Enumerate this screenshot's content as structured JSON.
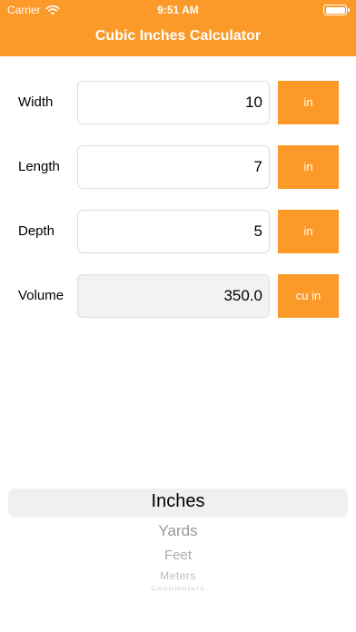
{
  "status": {
    "carrier": "Carrier",
    "time": "9:51 AM",
    "wifi_icon": "wifi-icon",
    "battery_icon": "battery-icon"
  },
  "header": {
    "title": "Cubic Inches Calculator",
    "color": "#fb9a28"
  },
  "rows": [
    {
      "label": "Width",
      "value": "10",
      "unit": "in"
    },
    {
      "label": "Length",
      "value": "7",
      "unit": "in"
    },
    {
      "label": "Depth",
      "value": "5",
      "unit": "in"
    },
    {
      "label": "Volume",
      "value": "350.0",
      "unit": "cu in"
    }
  ],
  "picker": {
    "selected": "Inches",
    "options": [
      "Inches",
      "Yards",
      "Feet",
      "Meters",
      "Centimeters"
    ]
  }
}
